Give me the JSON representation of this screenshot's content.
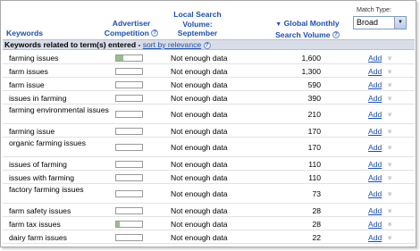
{
  "header": {
    "keywords": "Keywords",
    "competition": [
      "Advertiser",
      "Competition"
    ],
    "local": [
      "Local Search",
      "Volume: September"
    ],
    "global": [
      "Global Monthly",
      "Search Volume"
    ],
    "sort_indicator": "▼",
    "help_glyph": "?",
    "match_type_label": "Match Type:",
    "match_type_value": "Broad"
  },
  "section": {
    "title": "Keywords related to term(s) entered",
    "separator": " - ",
    "sort_link": "sort by relevance"
  },
  "rows": [
    {
      "keyword": "farming issues",
      "competition": 0.27,
      "local": "Not enough data",
      "global": "1,600",
      "action": "Add"
    },
    {
      "keyword": "farm issues",
      "competition": 0.0,
      "local": "Not enough data",
      "global": "1,300",
      "action": "Add"
    },
    {
      "keyword": "farm issue",
      "competition": 0.0,
      "local": "Not enough data",
      "global": "590",
      "action": "Add"
    },
    {
      "keyword": "issues in farming",
      "competition": 0.0,
      "local": "Not enough data",
      "global": "390",
      "action": "Add"
    },
    {
      "keyword": "farming environmental issues",
      "competition": 0.0,
      "local": "Not enough data",
      "global": "210",
      "action": "Add"
    },
    {
      "keyword": "farming issue",
      "competition": 0.0,
      "local": "Not enough data",
      "global": "170",
      "action": "Add"
    },
    {
      "keyword": "organic farming issues",
      "competition": 0.0,
      "local": "Not enough data",
      "global": "170",
      "action": "Add"
    },
    {
      "keyword": "issues of farming",
      "competition": 0.0,
      "local": "Not enough data",
      "global": "110",
      "action": "Add"
    },
    {
      "keyword": "issues with farming",
      "competition": 0.0,
      "local": "Not enough data",
      "global": "110",
      "action": "Add"
    },
    {
      "keyword": "factory farming issues",
      "competition": 0.0,
      "local": "Not enough data",
      "global": "73",
      "action": "Add"
    },
    {
      "keyword": "farm safety issues",
      "competition": 0.0,
      "local": "Not enough data",
      "global": "28",
      "action": "Add"
    },
    {
      "keyword": "farm tax issues",
      "competition": 0.13,
      "local": "Not enough data",
      "global": "28",
      "action": "Add"
    },
    {
      "keyword": "dairy farm issues",
      "competition": 0.0,
      "local": "Not enough data",
      "global": "22",
      "action": "Add"
    }
  ],
  "colors": {
    "link": "#1b4fb3",
    "competition_fill": "#96c08b",
    "section_bg": "#d9dde8"
  },
  "icons": {
    "help": "help-circle-icon",
    "row_menu": "double-chevron-down-icon",
    "select_arrow": "chevron-down-icon"
  }
}
